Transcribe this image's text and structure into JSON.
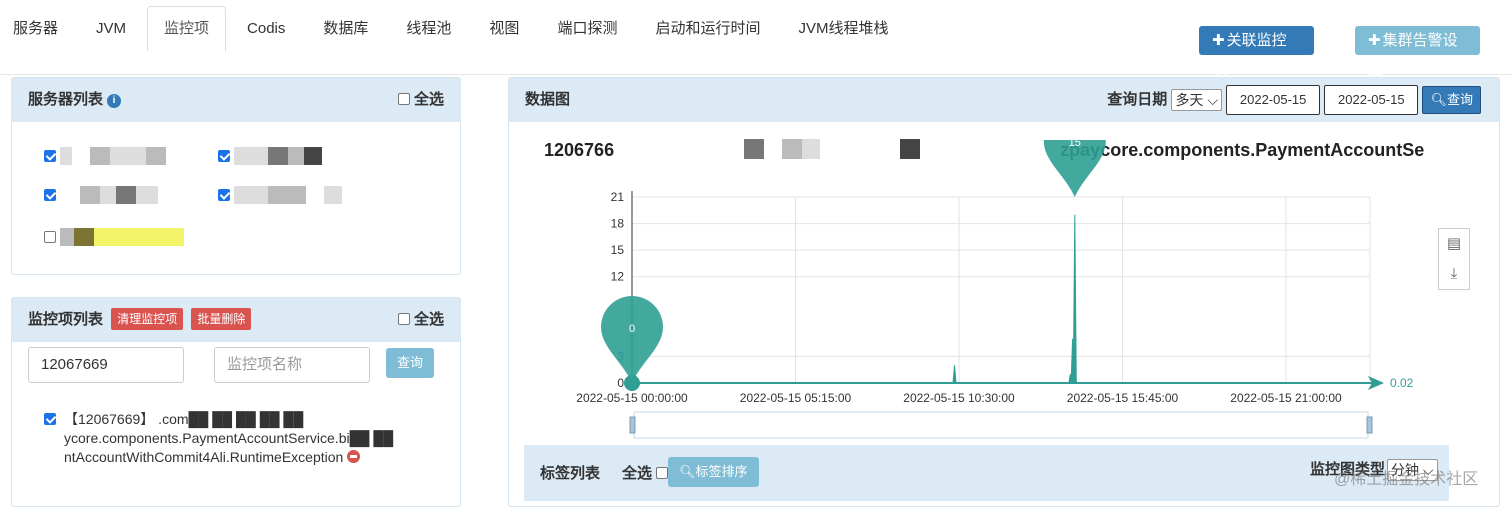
{
  "tabs": [
    "服务器",
    "JVM",
    "监控项",
    "Codis",
    "数据库",
    "线程池",
    "视图",
    "端口探测",
    "启动和运行时间",
    "JVM线程堆栈"
  ],
  "active_tab": 2,
  "buttons": {
    "add_monitor": "关联监控项",
    "cluster_alarm": "集群告警设置"
  },
  "server_panel": {
    "title": "服务器列表",
    "select_all": "全选"
  },
  "monitor_panel": {
    "title": "监控项列表",
    "clear_button": "清理监控项",
    "batch_delete_button": "批量删除",
    "select_all": "全选",
    "id_input_value": "12067669",
    "name_input_placeholder": "监控项名称",
    "query_button": "查询",
    "item_text": "【12067669】 .com██ ██ ██ ██ ██ ycore.components.PaymentAccountService.bi██ ██ ntAccountWithCommit4Ali.RuntimeException"
  },
  "data_panel": {
    "title": "数据图",
    "query_date_label": "查询日期",
    "range_select": "多天",
    "start_date": "2022-05-15",
    "end_date": "2022-05-15",
    "query_button": "查询"
  },
  "chart_title_left": "1206766",
  "chart_title_right": "zpaycore.components.PaymentAccountSe",
  "label_bar": {
    "title": "标签列表",
    "select_all": "全选",
    "sort_button": "标签排序",
    "chart_type_label": "监控图类型",
    "chart_type_value": "分钟"
  },
  "watermark": "@稀土掘金技术社区",
  "chart_data": {
    "type": "line",
    "x_ticks": [
      "2022-05-15 00:00:00",
      "2022-05-15 05:15:00",
      "2022-05-15 10:30:00",
      "2022-05-15 15:45:00",
      "2022-05-15 21:00:00"
    ],
    "y_ticks": [
      0,
      3,
      12,
      15,
      18,
      21
    ],
    "ylim": [
      0,
      21
    ],
    "x_axis_end_label": "0.02",
    "spikes": [
      {
        "pos": 0.0,
        "value": 0
      },
      {
        "pos": 0.437,
        "value": 2
      },
      {
        "pos": 0.594,
        "value": 1
      },
      {
        "pos": 0.597,
        "value": 5
      },
      {
        "pos": 0.6,
        "value": 19
      }
    ],
    "markers": [
      {
        "label": "0",
        "pos": 0.0,
        "value": 0
      },
      {
        "label": "15",
        "pos": 0.6,
        "value": 21
      }
    ],
    "color": "#2f9e94",
    "grid": true
  }
}
